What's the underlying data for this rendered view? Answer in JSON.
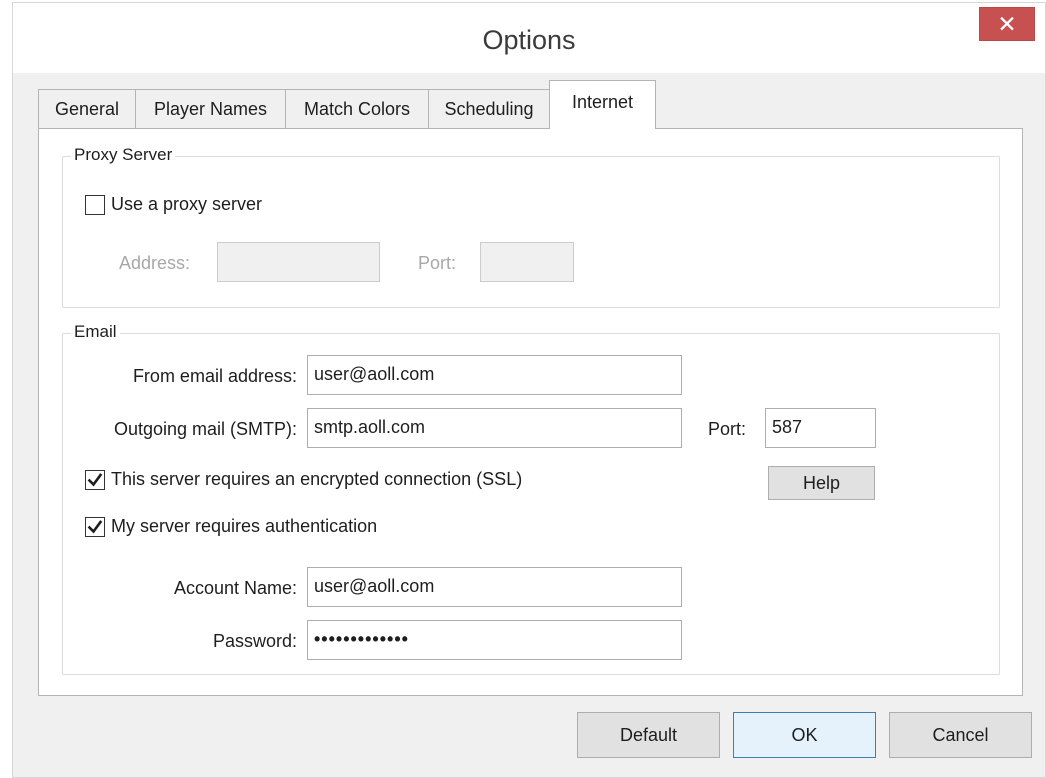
{
  "window": {
    "title": "Options",
    "close_glyph": "✕"
  },
  "tabs": [
    {
      "label": "General"
    },
    {
      "label": "Player Names"
    },
    {
      "label": "Match Colors"
    },
    {
      "label": "Scheduling"
    },
    {
      "label": "Internet",
      "active": true
    }
  ],
  "proxy": {
    "group_label": "Proxy Server",
    "use_proxy_label": "Use a proxy server",
    "use_proxy_checked": false,
    "address_label": "Address:",
    "address_value": "",
    "port_label": "Port:",
    "port_value": ""
  },
  "email": {
    "group_label": "Email",
    "from_label": "From email address:",
    "from_value": "user@aoll.com",
    "smtp_label": "Outgoing mail (SMTP):",
    "smtp_value": "smtp.aoll.com",
    "port_label": "Port:",
    "port_value": "587",
    "ssl_label": "This server requires an encrypted connection (SSL)",
    "ssl_checked": true,
    "help_label": "Help",
    "auth_label": "My server requires authentication",
    "auth_checked": true,
    "account_label": "Account Name:",
    "account_value": "user@aoll.com",
    "password_label": "Password:",
    "password_value": "•••••••••••••"
  },
  "footer": {
    "default_label": "Default",
    "ok_label": "OK",
    "cancel_label": "Cancel"
  },
  "icons": {
    "close": "close-icon",
    "check": "checkmark-icon"
  }
}
